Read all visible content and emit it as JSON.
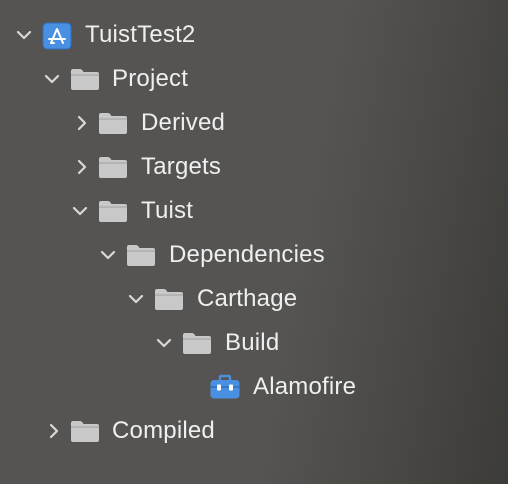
{
  "navigator": {
    "root": {
      "label": "TuistTest2",
      "icon": "xcode-project-icon",
      "expanded": true
    },
    "project": {
      "label": "Project",
      "icon": "folder-icon",
      "expanded": true
    },
    "derived": {
      "label": "Derived",
      "icon": "folder-icon",
      "expanded": false
    },
    "targets": {
      "label": "Targets",
      "icon": "folder-icon",
      "expanded": false
    },
    "tuist": {
      "label": "Tuist",
      "icon": "folder-icon",
      "expanded": true
    },
    "dependencies": {
      "label": "Dependencies",
      "icon": "folder-icon",
      "expanded": true
    },
    "carthage": {
      "label": "Carthage",
      "icon": "folder-icon",
      "expanded": true
    },
    "build": {
      "label": "Build",
      "icon": "folder-icon",
      "expanded": true
    },
    "alamofire": {
      "label": "Alamofire",
      "icon": "framework-toolbox-icon"
    },
    "compiled": {
      "label": "Compiled",
      "icon": "folder-icon",
      "expanded": false
    }
  },
  "colors": {
    "text": "#efefef",
    "folder": "#c8c8c8",
    "accent_blue": "#4a90e2",
    "chevron": "#d8d8d8"
  }
}
